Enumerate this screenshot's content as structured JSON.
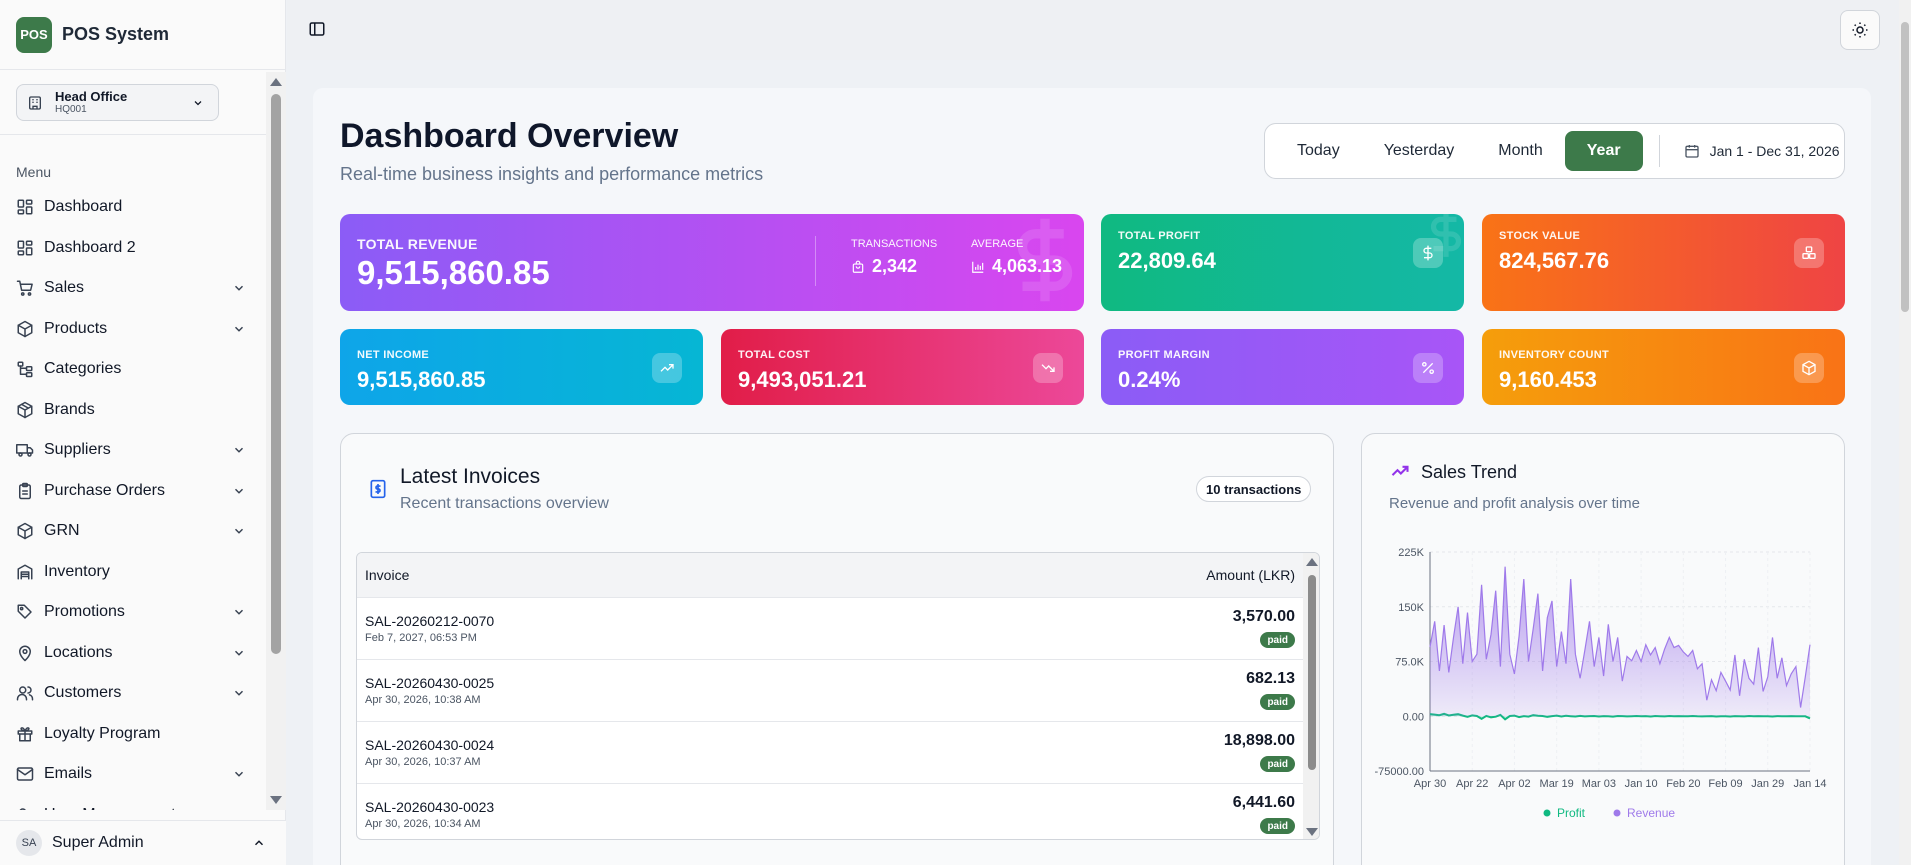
{
  "app": {
    "logo": "POS",
    "name": "POS System"
  },
  "branch": {
    "name": "Head Office",
    "code": "HQ001"
  },
  "sidebar": {
    "menu_label": "Menu",
    "items": [
      {
        "label": "Dashboard",
        "icon": "dashboard-icon",
        "expandable": false
      },
      {
        "label": "Dashboard 2",
        "icon": "dashboard-icon",
        "expandable": false
      },
      {
        "label": "Sales",
        "icon": "cart-icon",
        "expandable": true
      },
      {
        "label": "Products",
        "icon": "box-icon",
        "expandable": true
      },
      {
        "label": "Categories",
        "icon": "hierarchy-icon",
        "expandable": false
      },
      {
        "label": "Brands",
        "icon": "package-icon",
        "expandable": false
      },
      {
        "label": "Suppliers",
        "icon": "truck-icon",
        "expandable": true
      },
      {
        "label": "Purchase Orders",
        "icon": "clipboard-icon",
        "expandable": true
      },
      {
        "label": "GRN",
        "icon": "box-icon",
        "expandable": true
      },
      {
        "label": "Inventory",
        "icon": "warehouse-icon",
        "expandable": false
      },
      {
        "label": "Promotions",
        "icon": "tag-icon",
        "expandable": true
      },
      {
        "label": "Locations",
        "icon": "pin-icon",
        "expandable": true
      },
      {
        "label": "Customers",
        "icon": "users-icon",
        "expandable": true
      },
      {
        "label": "Loyalty Program",
        "icon": "gift-icon",
        "expandable": false
      },
      {
        "label": "Emails",
        "icon": "mail-icon",
        "expandable": true
      },
      {
        "label": "User Management",
        "icon": "user-cog-icon",
        "expandable": true
      }
    ]
  },
  "user": {
    "initials": "SA",
    "name": "Super Admin"
  },
  "header": {
    "title": "Dashboard Overview",
    "subtitle": "Real-time business insights and performance metrics",
    "ranges": [
      "Today",
      "Yesterday",
      "Month",
      "Year"
    ],
    "active_range": "Year",
    "date_range": "Jan 1 - Dec 31, 2026"
  },
  "stats": {
    "total_revenue": {
      "label": "TOTAL REVENUE",
      "value": "9,515,860.85",
      "transactions_label": "TRANSACTIONS",
      "transactions": "2,342",
      "average_label": "AVERAGE",
      "average": "4,063.13"
    },
    "total_profit": {
      "label": "TOTAL PROFIT",
      "value": "22,809.64"
    },
    "stock_value": {
      "label": "STOCK VALUE",
      "value": "824,567.76"
    },
    "net_income": {
      "label": "NET INCOME",
      "value": "9,515,860.85"
    },
    "total_cost": {
      "label": "TOTAL COST",
      "value": "9,493,051.21"
    },
    "profit_margin": {
      "label": "PROFIT MARGIN",
      "value": "0.24%"
    },
    "inventory_count": {
      "label": "INVENTORY COUNT",
      "value": "9,160.453"
    }
  },
  "invoices": {
    "title": "Latest Invoices",
    "subtitle": "Recent transactions overview",
    "badge": "10 transactions",
    "columns": [
      "Invoice",
      "Amount (LKR)"
    ],
    "rows": [
      {
        "id": "SAL-20260212-0070",
        "date": "Feb 7, 2027, 06:53 PM",
        "amount": "3,570.00",
        "status": "paid"
      },
      {
        "id": "SAL-20260430-0025",
        "date": "Apr 30, 2026, 10:38 AM",
        "amount": "682.13",
        "status": "paid"
      },
      {
        "id": "SAL-20260430-0024",
        "date": "Apr 30, 2026, 10:37 AM",
        "amount": "18,898.00",
        "status": "paid"
      },
      {
        "id": "SAL-20260430-0023",
        "date": "Apr 30, 2026, 10:34 AM",
        "amount": "6,441.60",
        "status": "paid"
      }
    ]
  },
  "trend": {
    "title": "Sales Trend",
    "subtitle": "Revenue and profit analysis over time"
  },
  "colors": {
    "brand": "#3d7a4a",
    "revenue": "#9f7aea",
    "profit": "#10b981"
  },
  "chart_data": {
    "type": "area",
    "x": [
      "Apr 30",
      "Apr 22",
      "Apr 02",
      "Mar 19",
      "Mar 03",
      "Jan 10",
      "Feb 20",
      "Feb 09",
      "Jan 29",
      "Jan 14"
    ],
    "ytick_labels": [
      "225K",
      "150K",
      "75.0K",
      "0.00",
      "-75000.00"
    ],
    "ylim": [
      -75000,
      225000
    ],
    "grid": true,
    "legend": "bottom",
    "series": [
      {
        "name": "Revenue",
        "values": [
          95000,
          130000,
          62000,
          125000,
          60000,
          108000,
          150000,
          72000,
          142000,
          75000,
          85000,
          180000,
          78000,
          112000,
          172000,
          68000,
          205000,
          85000,
          58000,
          110000,
          188000,
          75000,
          120000,
          168000,
          62000,
          135000,
          158000,
          68000,
          116000,
          72000,
          188000,
          85000,
          52000,
          90000,
          130000,
          68000,
          108000,
          55000,
          126000,
          75000,
          108000,
          48000,
          82000,
          76000,
          90000,
          75000,
          98000,
          84000,
          94000,
          72000,
          92000,
          108000,
          94000,
          97000,
          88000,
          82000,
          90000,
          65000,
          72000,
          22000,
          50000,
          35000,
          60000,
          48000,
          36000,
          84000,
          28000,
          78000,
          52000,
          44000,
          94000,
          34000,
          54000,
          108000,
          52000,
          80000,
          42000,
          58000,
          68000,
          12000,
          54000,
          98000
        ]
      },
      {
        "name": "Profit",
        "values": [
          3000,
          2200,
          1500,
          3400,
          1000,
          2000,
          2800,
          900,
          -800,
          1200,
          400,
          -3500,
          500,
          -1500,
          -600,
          1800,
          -4200,
          400,
          900,
          -1200,
          200,
          -500,
          1500,
          600,
          300,
          -800,
          200,
          900,
          -300,
          600,
          100,
          -400,
          500,
          -200,
          200,
          400,
          -300,
          200,
          100,
          -500,
          300,
          200,
          -200,
          100,
          300,
          -100,
          200,
          -300,
          400,
          100,
          -200,
          300,
          0,
          200,
          -100,
          100,
          300,
          0,
          -200,
          100,
          200,
          -300,
          100,
          0,
          -400,
          200,
          100,
          -200,
          300,
          -100,
          200,
          0,
          100,
          -300,
          200,
          100,
          -100,
          200,
          0,
          100,
          0,
          -3000
        ]
      }
    ]
  }
}
